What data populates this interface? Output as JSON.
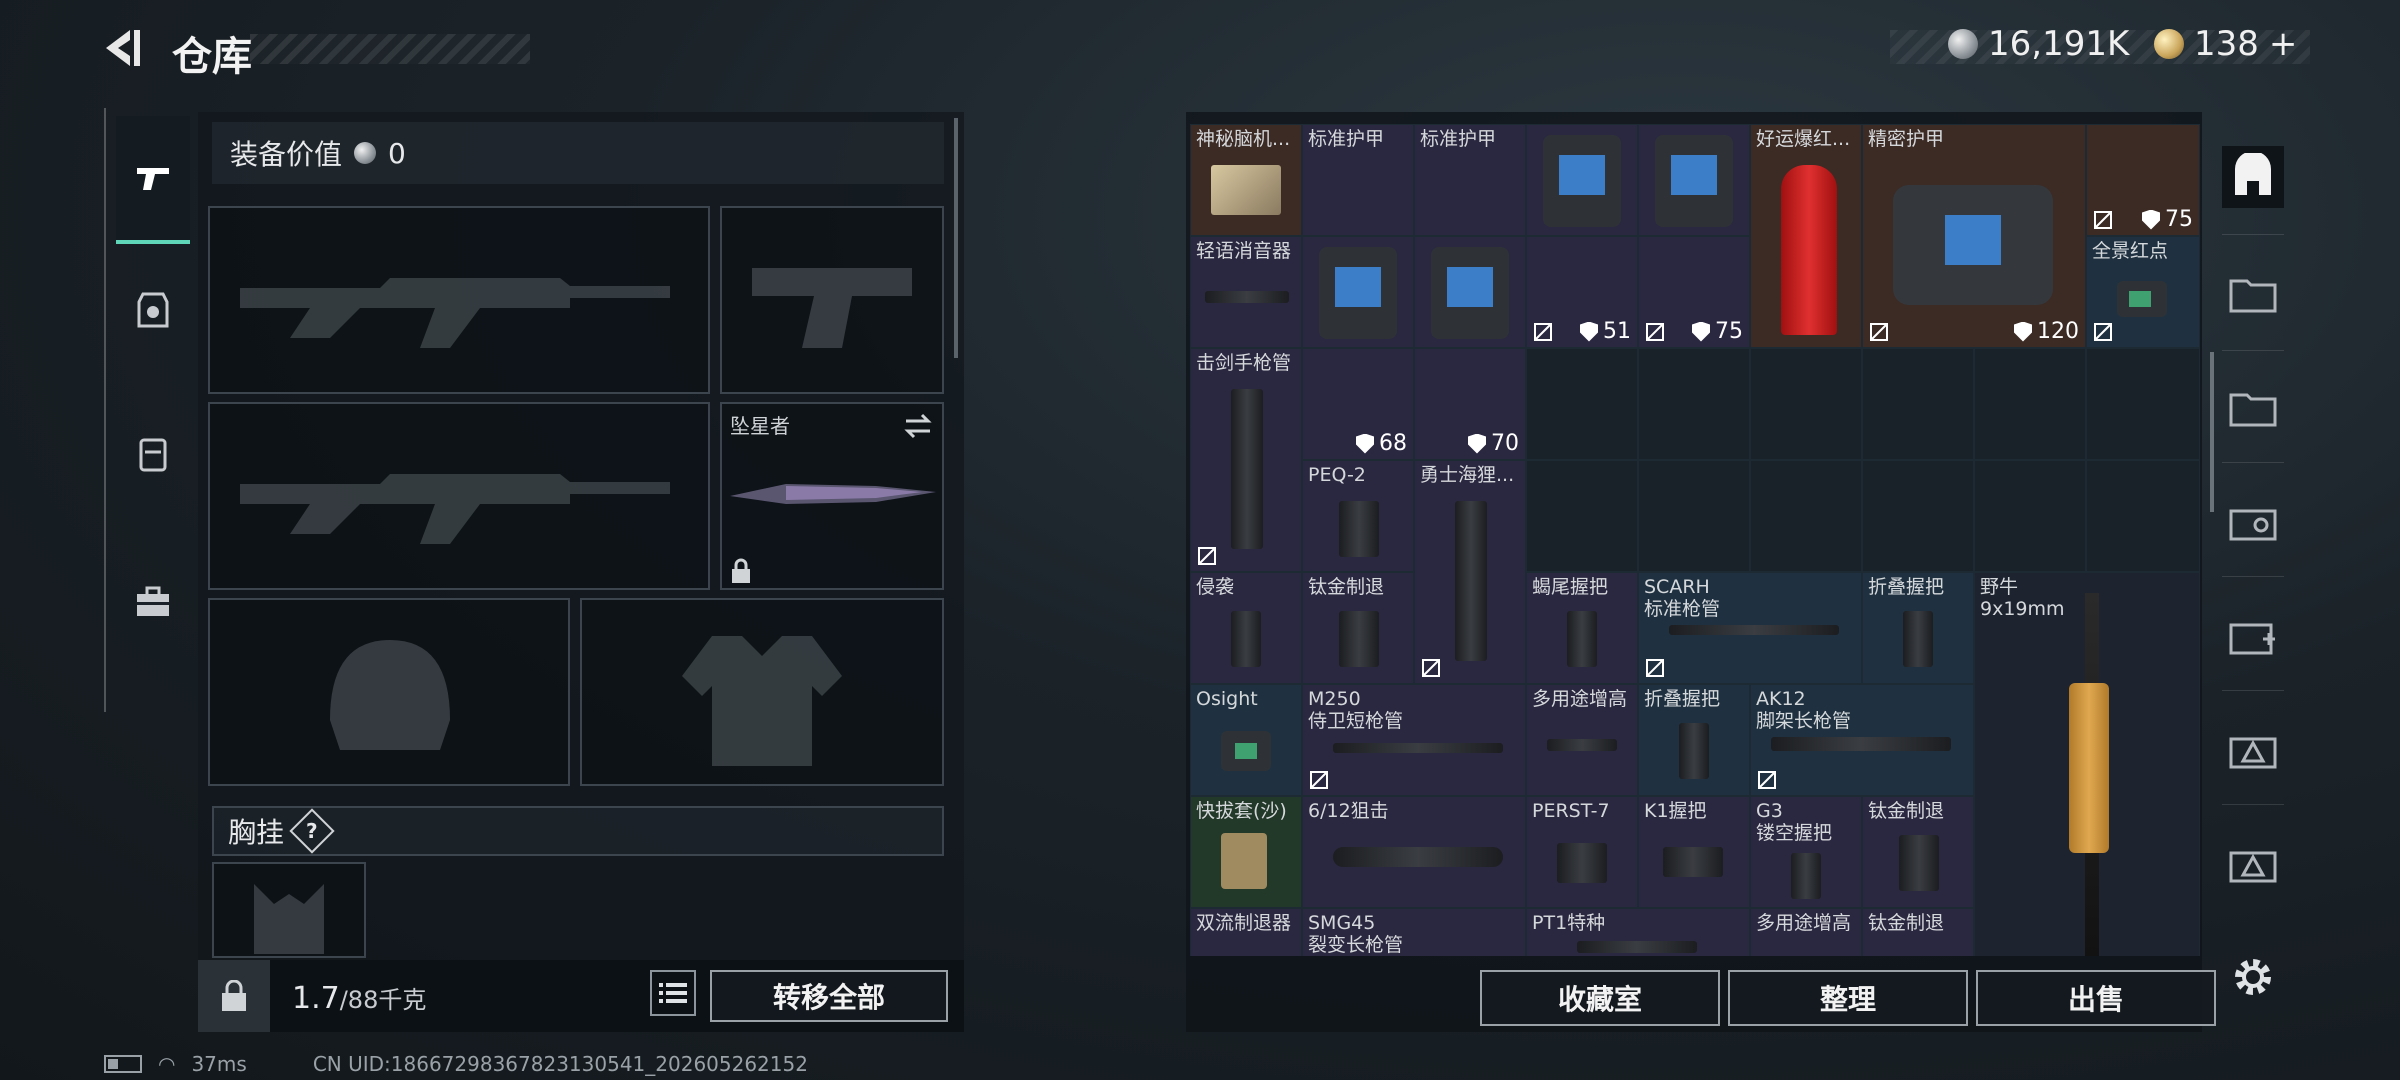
{
  "header": {
    "title": "仓库",
    "currency_silver": "16,191K",
    "currency_gold": "138",
    "currency_gold_add": "+"
  },
  "equipment": {
    "value_label": "装备价值",
    "value": "0",
    "melee_name": "坠星者",
    "chest_rig_label": "胸挂",
    "help_glyph": "?",
    "weight_current": "1.7",
    "weight_max": "/88千克",
    "transfer_all": "转移全部"
  },
  "stash": {
    "cells": {
      "c1": {
        "name": "神秘脑机..."
      },
      "c2": {
        "name": "标准护甲"
      },
      "c3": {
        "name": "标准护甲"
      },
      "c4": {
        "name": "好运爆红..."
      },
      "c5": {
        "name": "精密护甲"
      },
      "c6": {
        "durability": "75"
      },
      "c7": {
        "name": "轻语消音器"
      },
      "c8": {
        "durability": "51"
      },
      "c9": {
        "durability": "75"
      },
      "c10": {
        "durability": "120"
      },
      "c11": {
        "name": "全景红点"
      },
      "c12": {
        "name": "击剑手枪管"
      },
      "c13": {
        "durability": "68"
      },
      "c14": {
        "durability": "70"
      },
      "c15": {
        "name": "PEQ-2"
      },
      "c16": {
        "name": "勇士海狸..."
      },
      "c17": {
        "name": "侵袭"
      },
      "c18": {
        "name": "钛金制退"
      },
      "c19": {
        "name": "蝎尾握把"
      },
      "c20": {
        "name": "SCARH",
        "sub": "标准枪管"
      },
      "c21": {
        "name": "折叠握把"
      },
      "c22": {
        "name": "野牛",
        "sub": "9x19mm"
      },
      "c23": {
        "name": "Osight"
      },
      "c24": {
        "name": "M250",
        "sub": "侍卫短枪管"
      },
      "c25": {
        "name": "多用途增高"
      },
      "c26": {
        "name": "折叠握把"
      },
      "c27": {
        "name": "AK12",
        "sub": "脚架长枪管"
      },
      "c28": {
        "name": "快拔套(沙)"
      },
      "c29": {
        "name": "6/12狙击"
      },
      "c30": {
        "name": "PERST-7"
      },
      "c31": {
        "name": "K1握把"
      },
      "c32": {
        "name": "G3",
        "sub": "镂空握把"
      },
      "c33": {
        "name": "钛金制退"
      },
      "c34": {
        "name": "双流制退器"
      },
      "c35": {
        "name": "SMG45",
        "sub": "裂变长枪管"
      },
      "c36": {
        "name": "PT1特种"
      },
      "c37": {
        "name": "多用途增高"
      },
      "c38": {
        "name": "钛金制退"
      }
    },
    "buttons": {
      "collection": "收藏室",
      "organize": "整理",
      "sell": "出售"
    }
  },
  "status": {
    "ping": "37ms",
    "uid": "CN UID:18667298367823130541_202605262152"
  },
  "colors": {
    "accent": "#5fd6b7",
    "rarity_purple": "#2a2740",
    "rarity_blue": "#1f3140",
    "rarity_gold": "#3c2a24",
    "rarity_green": "#223828"
  },
  "icons": [
    "back-arrow-icon",
    "silver-coin-icon",
    "gold-coin-icon",
    "pistol-icon",
    "armor-icon",
    "backpack-icon",
    "toolbox-icon",
    "lock-icon",
    "list-icon",
    "swap-icon",
    "settings-icon",
    "no-insure-icon",
    "shield-icon"
  ]
}
